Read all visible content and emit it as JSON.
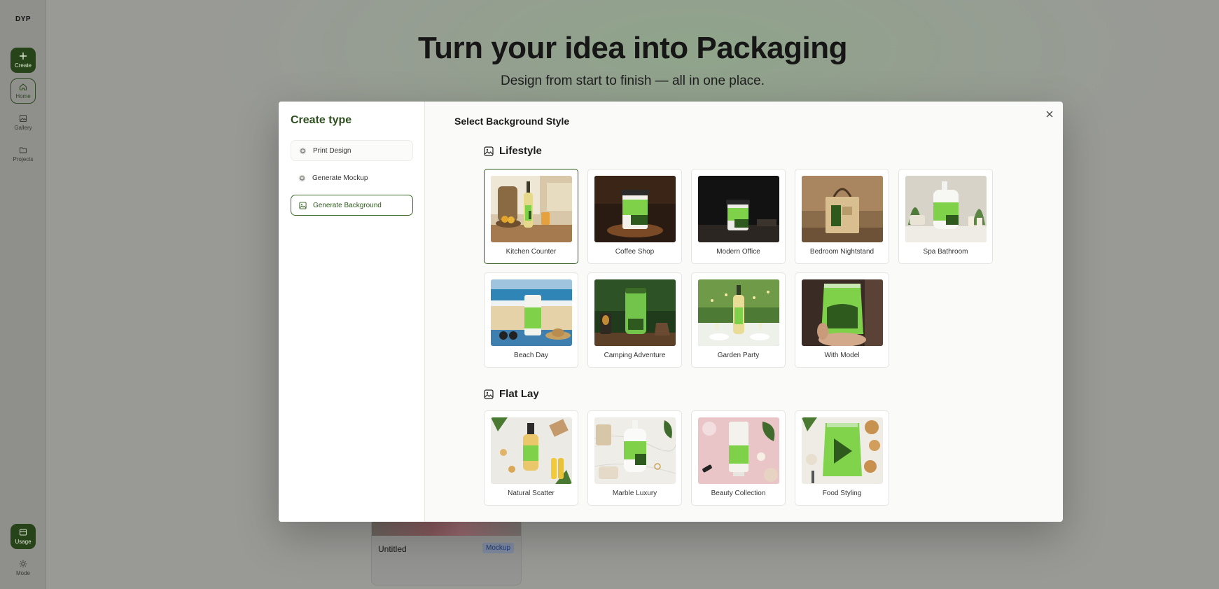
{
  "app": {
    "logo": "DYP",
    "nav": {
      "create": "Create",
      "home": "Home",
      "gallery": "Gallery",
      "projects": "Projects",
      "usage": "Usage",
      "mode": "Mode"
    }
  },
  "hero": {
    "title": "Turn your idea into Packaging",
    "subtitle": "Design from start to finish — all in one place."
  },
  "project_card": {
    "name": "Untitled",
    "tag": "Mockup"
  },
  "modal": {
    "create_type_title": "Create type",
    "types": [
      {
        "label": "Print Design",
        "icon": "cube-icon"
      },
      {
        "label": "Generate Mockup",
        "icon": "cube-icon"
      },
      {
        "label": "Generate Background",
        "icon": "image-icon",
        "selected": true
      }
    ],
    "heading": "Select Background Style",
    "groups": [
      {
        "title": "Lifestyle",
        "items": [
          {
            "label": "Kitchen Counter",
            "selected": true
          },
          {
            "label": "Coffee Shop"
          },
          {
            "label": "Modern Office"
          },
          {
            "label": "Bedroom Nightstand"
          },
          {
            "label": "Spa Bathroom"
          },
          {
            "label": "Beach Day"
          },
          {
            "label": "Camping Adventure"
          },
          {
            "label": "Garden Party"
          },
          {
            "label": "With Model"
          }
        ]
      },
      {
        "title": "Flat Lay",
        "items": [
          {
            "label": "Natural Scatter"
          },
          {
            "label": "Marble Luxury"
          },
          {
            "label": "Beauty Collection"
          },
          {
            "label": "Food Styling"
          }
        ]
      }
    ]
  },
  "colors": {
    "brand_green": "#2d4f1e",
    "accent_green": "#7fd14a",
    "selected_border": "#2f5a1e"
  }
}
